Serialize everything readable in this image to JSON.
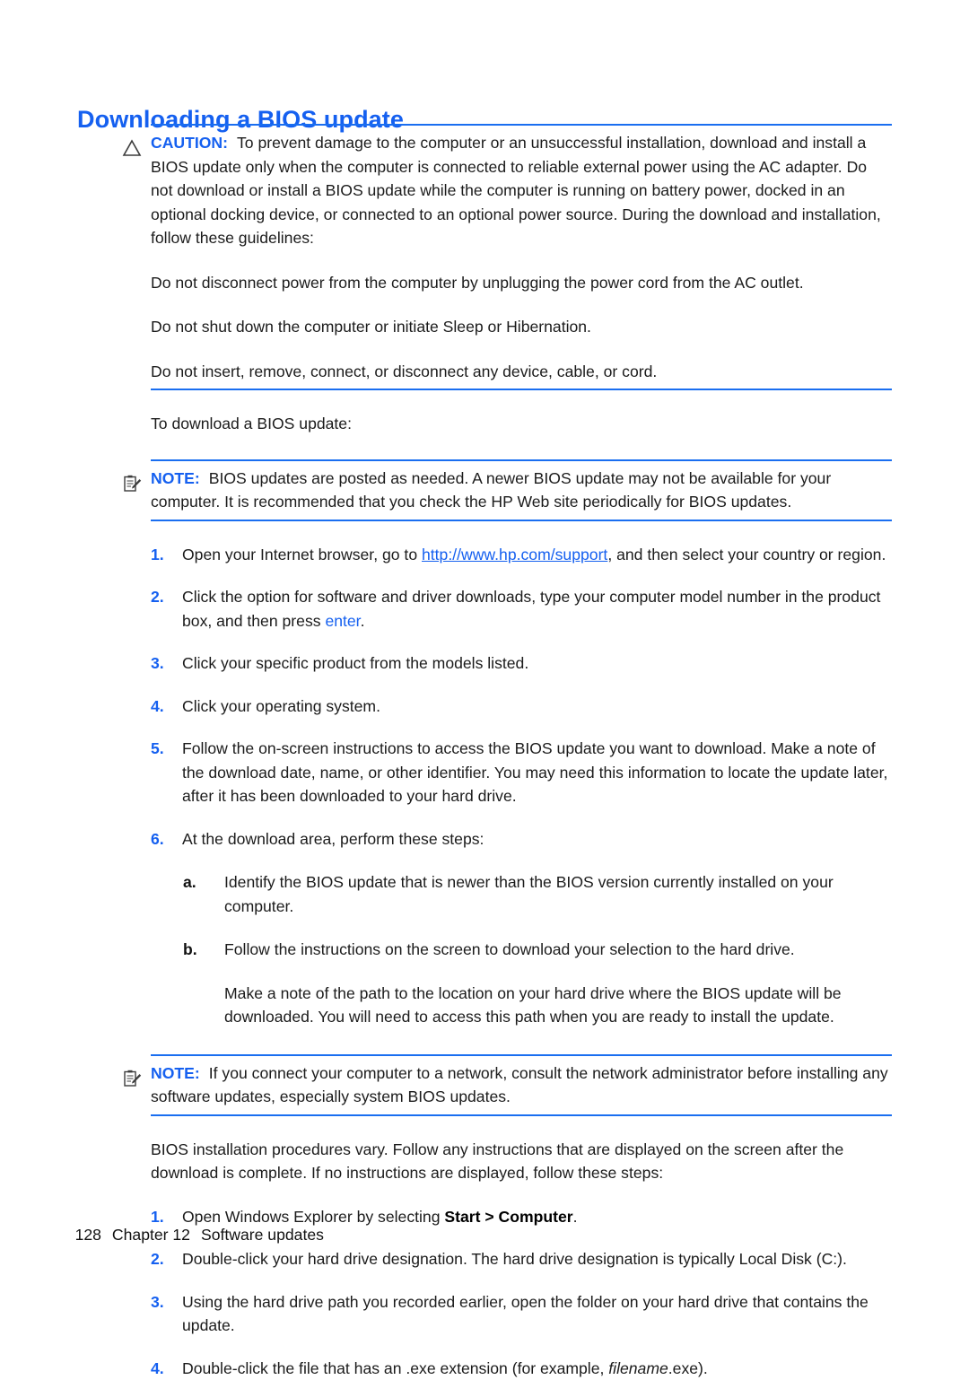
{
  "document": {
    "title": "Downloading a BIOS update"
  },
  "caution": {
    "icon": "warning-triangle-icon",
    "label": "CAUTION:",
    "text": "To prevent damage to the computer or an unsuccessful installation, download and install a BIOS update only when the computer is connected to reliable external power using the AC adapter. Do not download or install a BIOS update while the computer is running on battery power, docked in an optional docking device, or connected to an optional power source. During the download and installation, follow these guidelines:",
    "guidelines": [
      "Do not disconnect power from the computer by unplugging the power cord from the AC outlet.",
      "Do not shut down the computer or initiate Sleep or Hibernation.",
      "Do not insert, remove, connect, or disconnect any device, cable, or cord."
    ]
  },
  "intro": {
    "text": "To download a BIOS update:"
  },
  "note_1": {
    "icon": "note-clipboard-icon",
    "label": "NOTE:",
    "text": "BIOS updates are posted as needed. A newer BIOS update may not be available for your computer. It is recommended that you check the HP Web site periodically for BIOS updates."
  },
  "steps_download": {
    "items": [
      {
        "marker": "1.",
        "before": "Open your Internet browser, go to ",
        "link": "http://www.hp.com/support",
        "after": ", and then select your country or region."
      },
      {
        "marker": "2.",
        "before": "Click the option for software and driver downloads, type your computer model number in the product box, and then press ",
        "key": "enter",
        "after": "."
      },
      {
        "marker": "3.",
        "text": "Click your specific product from the models listed."
      },
      {
        "marker": "4.",
        "text": "Click your operating system."
      },
      {
        "marker": "5.",
        "text": "Follow the on-screen instructions to access the BIOS update you want to download. Make a note of the download date, name, or other identifier. You may need this information to locate the update later, after it has been downloaded to your hard drive."
      },
      {
        "marker": "6.",
        "text": "At the download area, perform these steps:"
      }
    ],
    "substeps": [
      {
        "marker": "a.",
        "text": "Identify the BIOS update that is newer than the BIOS version currently installed on your computer."
      },
      {
        "marker": "b.",
        "text": "Follow the instructions on the screen to download your selection to the hard drive."
      }
    ],
    "substep_continuation": "Make a note of the path to the location on your hard drive where the BIOS update will be downloaded. You will need to access this path when you are ready to install the update."
  },
  "note_2": {
    "icon": "note-clipboard-icon",
    "label": "NOTE:",
    "text": "If you connect your computer to a network, consult the network administrator before installing any software updates, especially system BIOS updates."
  },
  "install_intro": {
    "text": "BIOS installation procedures vary. Follow any instructions that are displayed on the screen after the download is complete. If no instructions are displayed, follow these steps:"
  },
  "steps_install": {
    "items": [
      {
        "marker": "1.",
        "before": "Open Windows Explorer by selecting ",
        "bold": "Start > Computer",
        "after": "."
      },
      {
        "marker": "2.",
        "text": "Double-click your hard drive designation. The hard drive designation is typically Local Disk (C:)."
      },
      {
        "marker": "3.",
        "text": "Using the hard drive path you recorded earlier, open the folder on your hard drive that contains the update."
      },
      {
        "marker": "4.",
        "before": "Double-click the file that has an .exe extension (for example, ",
        "italic": "filename",
        "after": ".exe)."
      }
    ]
  },
  "footer": {
    "page_number": "128",
    "chapter": "Chapter 12",
    "chapter_title": "Software updates"
  },
  "colors": {
    "accent_blue": "#1560f0",
    "rule_blue": "#1a6ef0",
    "text_black": "#1b1b1b"
  }
}
